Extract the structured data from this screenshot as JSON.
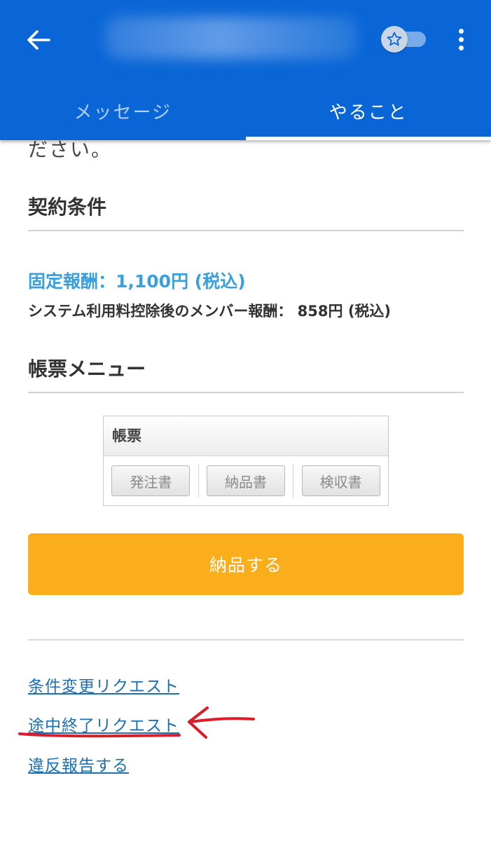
{
  "header": {
    "title": "",
    "tabs": [
      {
        "label": "メッセージ",
        "active": false
      },
      {
        "label": "やること",
        "active": true
      }
    ]
  },
  "content": {
    "cut_off_text": "ださい。",
    "contract": {
      "heading": "契約条件",
      "fixed_fee": "固定報酬：1,100円 (税込)",
      "member_fee": "システム利用料控除後のメンバー報酬： 858円 (税込)"
    },
    "documents": {
      "heading": "帳票メニュー",
      "table_header": "帳票",
      "buttons": [
        "発注書",
        "納品書",
        "検収書"
      ]
    },
    "deliver_button": "納品する",
    "links": {
      "change_request": "条件変更リクエスト",
      "early_end_request": "途中終了リクエスト",
      "report_violation": "違反報告する"
    }
  },
  "colors": {
    "header_bg": "#0a66d6",
    "fee_blue": "#3aa0dc",
    "deliver_orange": "#fbae1b",
    "link_blue": "#1e6fb0",
    "annotation_red": "#d91e2a"
  },
  "icons": {
    "back": "arrow-left-icon",
    "favorite": "star-icon",
    "more": "more-vertical-icon"
  }
}
